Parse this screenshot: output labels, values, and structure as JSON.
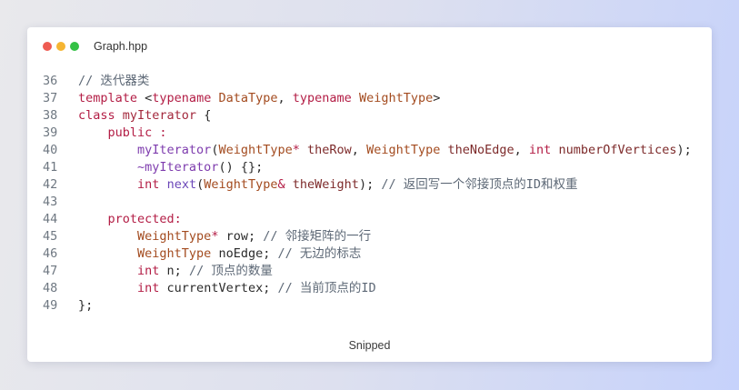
{
  "background": {
    "from": "#e9e9ec",
    "mid": "#dde0ef",
    "to": "#c6d2fb"
  },
  "window": {
    "title": "Graph.hpp",
    "dot_colors": [
      "#ee5b52",
      "#f5b532",
      "#34c145"
    ]
  },
  "code": {
    "plain_color": "#2b2b2b",
    "lines": [
      {
        "number": "36",
        "tokens": [
          {
            "text": "// 迭代器类",
            "color": "#5d6876"
          }
        ]
      },
      {
        "number": "37",
        "tokens": [
          {
            "text": "template",
            "color": "#b31d45"
          },
          {
            "text": " <"
          },
          {
            "text": "typename",
            "color": "#b31d45"
          },
          {
            "text": " "
          },
          {
            "text": "DataType",
            "color": "#a34b1f"
          },
          {
            "text": ", "
          },
          {
            "text": "typename",
            "color": "#b31d45"
          },
          {
            "text": " "
          },
          {
            "text": "WeightType",
            "color": "#a34b1f"
          },
          {
            "text": ">"
          }
        ]
      },
      {
        "number": "38",
        "tokens": [
          {
            "text": "class",
            "color": "#b31d45"
          },
          {
            "text": " "
          },
          {
            "text": "myIterator",
            "color": "#a3283c"
          },
          {
            "text": " {"
          }
        ]
      },
      {
        "number": "39",
        "tokens": [
          {
            "text": "    "
          },
          {
            "text": "public :",
            "color": "#b31d45"
          }
        ]
      },
      {
        "number": "40",
        "tokens": [
          {
            "text": "        "
          },
          {
            "text": "myIterator",
            "color": "#7e3cae"
          },
          {
            "text": "("
          },
          {
            "text": "WeightType",
            "color": "#a34b1f"
          },
          {
            "text": "*",
            "color": "#b31d45"
          },
          {
            "text": " "
          },
          {
            "text": "theRow",
            "color": "#7d2a2a"
          },
          {
            "text": ", "
          },
          {
            "text": "WeightType",
            "color": "#a34b1f"
          },
          {
            "text": " "
          },
          {
            "text": "theNoEdge",
            "color": "#7d2a2a"
          },
          {
            "text": ", "
          },
          {
            "text": "int",
            "color": "#b31d45"
          },
          {
            "text": " "
          },
          {
            "text": "numberOfVertices",
            "color": "#7d2a2a"
          },
          {
            "text": ");"
          }
        ]
      },
      {
        "number": "41",
        "tokens": [
          {
            "text": "        "
          },
          {
            "text": "~myIterator",
            "color": "#7e3cae"
          },
          {
            "text": "() {};"
          }
        ]
      },
      {
        "number": "42",
        "tokens": [
          {
            "text": "        "
          },
          {
            "text": "int",
            "color": "#b31d45"
          },
          {
            "text": " "
          },
          {
            "text": "next",
            "color": "#6a46b8"
          },
          {
            "text": "("
          },
          {
            "text": "WeightType",
            "color": "#a34b1f"
          },
          {
            "text": "&",
            "color": "#b31d45"
          },
          {
            "text": " "
          },
          {
            "text": "theWeight",
            "color": "#7d2a2a"
          },
          {
            "text": "); "
          },
          {
            "text": "// 返回写一个邻接顶点的ID和权重",
            "color": "#5d6876"
          }
        ]
      },
      {
        "number": "43",
        "tokens": []
      },
      {
        "number": "44",
        "tokens": [
          {
            "text": "    "
          },
          {
            "text": "protected:",
            "color": "#b31d45"
          }
        ]
      },
      {
        "number": "45",
        "tokens": [
          {
            "text": "        "
          },
          {
            "text": "WeightType",
            "color": "#a34b1f"
          },
          {
            "text": "*",
            "color": "#b31d45"
          },
          {
            "text": " row; "
          },
          {
            "text": "// 邻接矩阵的一行",
            "color": "#5d6876"
          }
        ]
      },
      {
        "number": "46",
        "tokens": [
          {
            "text": "        "
          },
          {
            "text": "WeightType",
            "color": "#a34b1f"
          },
          {
            "text": " noEdge; "
          },
          {
            "text": "// 无边的标志",
            "color": "#5d6876"
          }
        ]
      },
      {
        "number": "47",
        "tokens": [
          {
            "text": "        "
          },
          {
            "text": "int",
            "color": "#b31d45"
          },
          {
            "text": " n; "
          },
          {
            "text": "// 顶点的数量",
            "color": "#5d6876"
          }
        ]
      },
      {
        "number": "48",
        "tokens": [
          {
            "text": "        "
          },
          {
            "text": "int",
            "color": "#b31d45"
          },
          {
            "text": " currentVertex; "
          },
          {
            "text": "// 当前顶点的ID",
            "color": "#5d6876"
          }
        ]
      },
      {
        "number": "49",
        "tokens": [
          {
            "text": "};"
          }
        ]
      }
    ]
  },
  "footer": {
    "label": "Snipped"
  }
}
